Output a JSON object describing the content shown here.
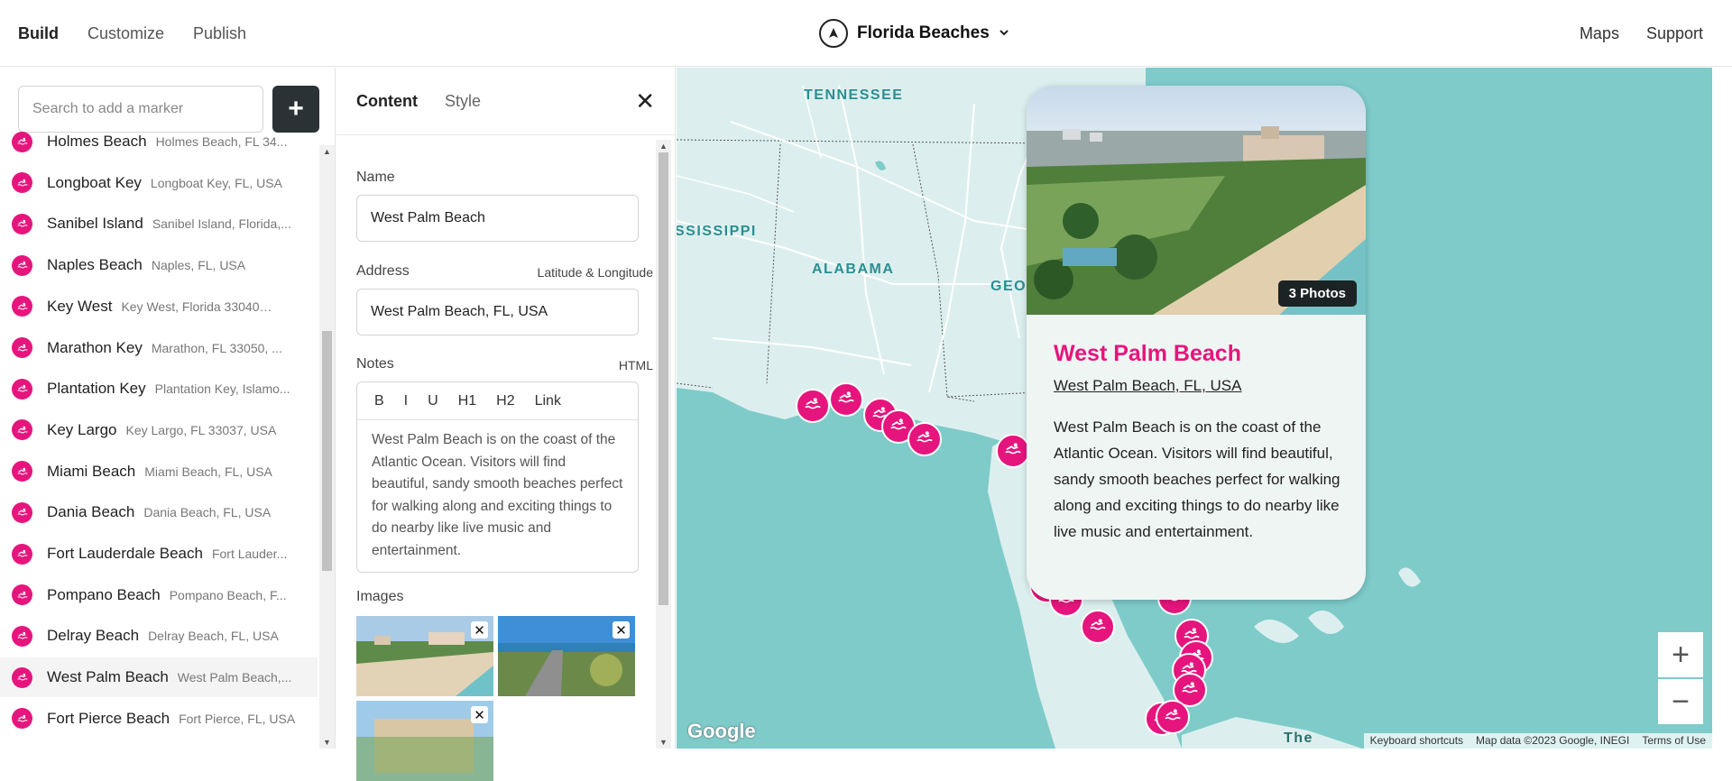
{
  "topbar": {
    "nav": [
      "Build",
      "Customize",
      "Publish"
    ],
    "project_title": "Florida Beaches",
    "right_links": [
      "Maps",
      "Support"
    ]
  },
  "sidebar": {
    "search_placeholder": "Search to add a marker",
    "add_label": "+",
    "markers": [
      {
        "name": "Holmes Beach",
        "address": "Holmes Beach, FL 34..."
      },
      {
        "name": "Longboat Key",
        "address": "Longboat Key, FL, USA"
      },
      {
        "name": "Sanibel Island",
        "address": "Sanibel Island, Florida,..."
      },
      {
        "name": "Naples Beach",
        "address": "Naples, FL, USA"
      },
      {
        "name": "Key West",
        "address": "Key West, Florida 33040, USA"
      },
      {
        "name": "Marathon Key",
        "address": "Marathon, FL 33050, ..."
      },
      {
        "name": "Plantation Key",
        "address": "Plantation Key, Islamo..."
      },
      {
        "name": "Key Largo",
        "address": "Key Largo, FL 33037, USA"
      },
      {
        "name": "Miami Beach",
        "address": "Miami Beach, FL, USA"
      },
      {
        "name": "Dania Beach",
        "address": "Dania Beach, FL, USA"
      },
      {
        "name": "Fort Lauderdale Beach",
        "address": "Fort Lauder..."
      },
      {
        "name": "Pompano Beach",
        "address": "Pompano Beach, F..."
      },
      {
        "name": "Delray Beach",
        "address": "Delray Beach, FL, USA"
      },
      {
        "name": "West Palm Beach",
        "address": "West Palm Beach,..."
      },
      {
        "name": "Fort Pierce Beach",
        "address": "Fort Pierce, FL, USA"
      }
    ],
    "selected_index": 13
  },
  "editor": {
    "tabs": [
      "Content",
      "Style"
    ],
    "close_label": "✕",
    "name_label": "Name",
    "name_value": "West Palm Beach",
    "address_label": "Address",
    "address_aside": "Latitude & Longitude",
    "address_value": "West Palm Beach, FL, USA",
    "notes_label": "Notes",
    "notes_aside": "HTML",
    "toolbar": [
      "B",
      "I",
      "U",
      "H1",
      "H2",
      "Link"
    ],
    "notes_text": "West Palm Beach is on the coast of the Atlantic Ocean. Visitors will find beautiful, sandy smooth beaches perfect for walking along and exciting things to do nearby like live music and entertainment.",
    "images_label": "Images"
  },
  "map": {
    "state_labels": [
      "TENNESSEE",
      "SSISSIPPI",
      "ALABAMA",
      "GEO"
    ],
    "popup": {
      "photos_badge": "3 Photos",
      "title": "West Palm Beach",
      "address": "West Palm Beach, FL, USA",
      "description": "West Palm Beach is on the coast of the Atlantic Ocean. Visitors will find beautiful, sandy smooth beaches perfect for walking along and exciting things to do nearby like live music and entertainment."
    },
    "zoom_in": "+",
    "zoom_out": "−",
    "google_mark": "Google",
    "partial_label": "The",
    "attribution": [
      "Keyboard shortcuts",
      "Map data ©2023 Google, INEGI",
      "Terms of Use"
    ]
  },
  "colors": {
    "accent": "#e6157d",
    "water": "#7ecbca",
    "land": "#dcefee"
  }
}
